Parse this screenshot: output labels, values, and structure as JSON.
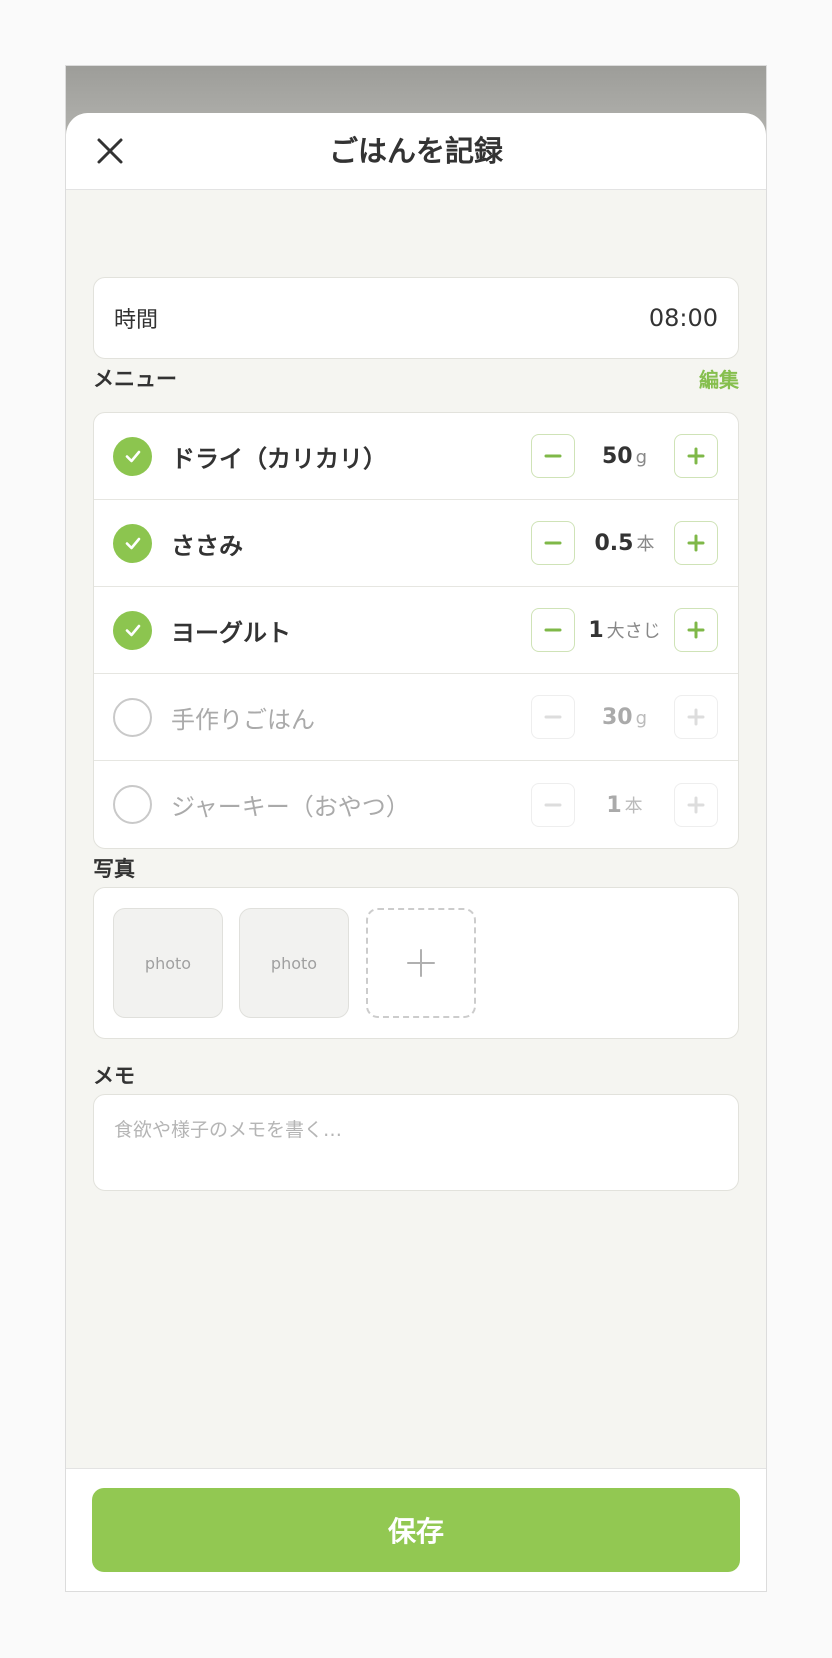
{
  "header": {
    "title": "ごはんを記録",
    "close_icon": "close-icon"
  },
  "time": {
    "label": "時間",
    "value": "08:00"
  },
  "menu": {
    "label": "メニュー",
    "edit_label": "編集",
    "items": [
      {
        "name": "ドライ（カリカリ）",
        "checked": true,
        "quantity": "50",
        "unit": "g"
      },
      {
        "name": "ささみ",
        "checked": true,
        "quantity": "0.5",
        "unit": "本"
      },
      {
        "name": "ヨーグルト",
        "checked": true,
        "quantity": "1",
        "unit": "大さじ"
      },
      {
        "name": "手作りごはん",
        "checked": false,
        "quantity": "30",
        "unit": "g"
      },
      {
        "name": "ジャーキー（おやつ）",
        "checked": false,
        "quantity": "1",
        "unit": "本"
      }
    ]
  },
  "photos": {
    "label": "写真",
    "thumbs": [
      "photo",
      "photo"
    ],
    "add_icon": "plus-icon"
  },
  "memo": {
    "label": "メモ",
    "placeholder": "食欲や様子のメモを書く…"
  },
  "footer": {
    "save_label": "保存"
  },
  "colors": {
    "accent": "#92c852",
    "check_on": "#8cc54f",
    "edit_link": "#86bf4e"
  }
}
